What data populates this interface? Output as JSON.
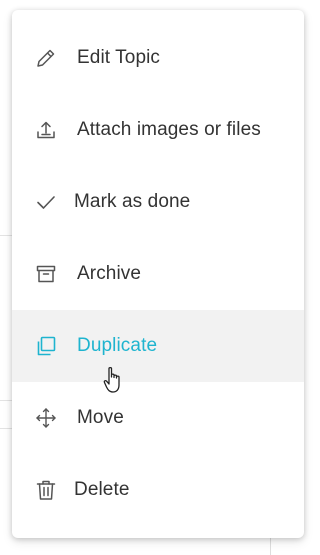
{
  "menu": {
    "items": [
      {
        "label": "Edit Topic",
        "icon": "pencil-icon"
      },
      {
        "label": "Attach images or files",
        "icon": "upload-icon"
      },
      {
        "label": "Mark as done",
        "icon": "checkmark-icon"
      },
      {
        "label": "Archive",
        "icon": "archive-box-icon"
      },
      {
        "label": "Duplicate",
        "icon": "duplicate-icon",
        "state": "hovered"
      },
      {
        "label": "Move",
        "icon": "move-arrows-icon"
      },
      {
        "label": "Delete",
        "icon": "trash-icon"
      }
    ]
  },
  "colors": {
    "text": "#333333",
    "icon": "#555555",
    "accent": "#1eb4cf",
    "hover_bg": "#f2f2f2"
  }
}
